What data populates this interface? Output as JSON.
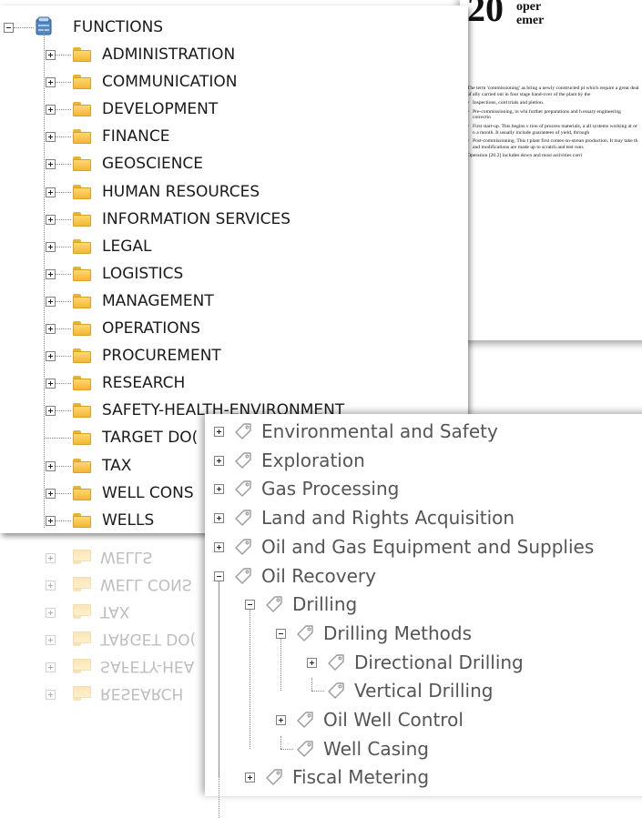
{
  "document": {
    "chapter_number": "20",
    "title_lines": "oper\nemer",
    "intro": "The term 'commissioning' as bring a newly constructed pl which require a great deal of ally carried out in four stage hand-over of the plant by the",
    "bullets": [
      "Inspections, cold trials and pletion.",
      "Pre-commissioning, in whi further preparations and h essary engineering correctio",
      "First start-up. This begins v tion of process materials, a all systems working at or n a month. It usually include guarantees of yield, through",
      "Post-commissioning. This t plant first comes on-strean production. It may take th and modifications are made up to scratch and test runs"
    ],
    "closing": "Operation [20.2] includes down and most activities carri"
  },
  "functions_tree": {
    "root_label": "FUNCTIONS",
    "items": [
      {
        "label": "ADMINISTRATION",
        "expandable": true
      },
      {
        "label": "COMMUNICATION",
        "expandable": true
      },
      {
        "label": "DEVELOPMENT",
        "expandable": true
      },
      {
        "label": "FINANCE",
        "expandable": true
      },
      {
        "label": "GEOSCIENCE",
        "expandable": true
      },
      {
        "label": "HUMAN RESOURCES",
        "expandable": true
      },
      {
        "label": "INFORMATION SERVICES",
        "expandable": true
      },
      {
        "label": "LEGAL",
        "expandable": true
      },
      {
        "label": "LOGISTICS",
        "expandable": true
      },
      {
        "label": "MANAGEMENT",
        "expandable": true
      },
      {
        "label": "OPERATIONS",
        "expandable": true
      },
      {
        "label": "PROCUREMENT",
        "expandable": true
      },
      {
        "label": "RESEARCH",
        "expandable": true
      },
      {
        "label": "SAFETY-HEALTH-ENVIRONMENT",
        "expandable": true
      },
      {
        "label": "TARGET DO(",
        "expandable": false
      },
      {
        "label": "TAX",
        "expandable": true
      },
      {
        "label": "WELL CONS",
        "expandable": true
      },
      {
        "label": "WELLS",
        "expandable": true
      }
    ]
  },
  "reflection_labels": [
    "WELLS",
    "WELL CONS",
    "TAX",
    "TARGET DO(",
    "SAFETY-HEA",
    "RESEARCH"
  ],
  "tag_tree": {
    "items": [
      {
        "label": "Environmental and Safety",
        "level": 0,
        "state": "plus"
      },
      {
        "label": "Exploration",
        "level": 0,
        "state": "plus"
      },
      {
        "label": "Gas Processing",
        "level": 0,
        "state": "plus"
      },
      {
        "label": "Land and Rights Acquisition",
        "level": 0,
        "state": "plus"
      },
      {
        "label": "Oil and Gas Equipment and Supplies",
        "level": 0,
        "state": "plus"
      },
      {
        "label": "Oil Recovery",
        "level": 0,
        "state": "minus"
      },
      {
        "label": "Drilling",
        "level": 1,
        "state": "minus"
      },
      {
        "label": "Drilling Methods",
        "level": 2,
        "state": "minus"
      },
      {
        "label": "Directional Drilling",
        "level": 3,
        "state": "plus"
      },
      {
        "label": "Vertical Drilling",
        "level": 3,
        "state": "leaf"
      },
      {
        "label": "Oil Well Control",
        "level": 2,
        "state": "plus"
      },
      {
        "label": "Well Casing",
        "level": 2,
        "state": "leaf"
      },
      {
        "label": "Fiscal Metering",
        "level": 1,
        "state": "plus"
      }
    ]
  },
  "colors": {
    "folder": "#f2b634",
    "tag_outline": "#9a9a9a",
    "tree_text": "#1a1a1a",
    "tag_text": "#555555"
  }
}
